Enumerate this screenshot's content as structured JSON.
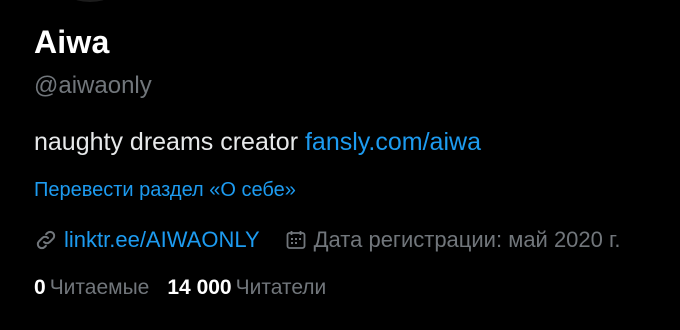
{
  "profile": {
    "display_name": "Aiwa",
    "handle": "@aiwaonly",
    "bio_text": "naughty dreams creator ",
    "bio_link": "fansly.com/aiwa",
    "translate_label": "Перевести раздел «О себе»",
    "website": "linktr.ee/AIWAONLY",
    "joined": "Дата регистрации: май 2020 г.",
    "following_count": "0",
    "following_label": "Читаемые",
    "followers_count": "14 000",
    "followers_label": "Читатели"
  },
  "icons": {
    "link": "link-icon",
    "calendar": "calendar-icon"
  },
  "colors": {
    "background": "#000000",
    "primary_text": "#e7e9ea",
    "secondary_text": "#71767b",
    "accent": "#1d9bf0"
  }
}
